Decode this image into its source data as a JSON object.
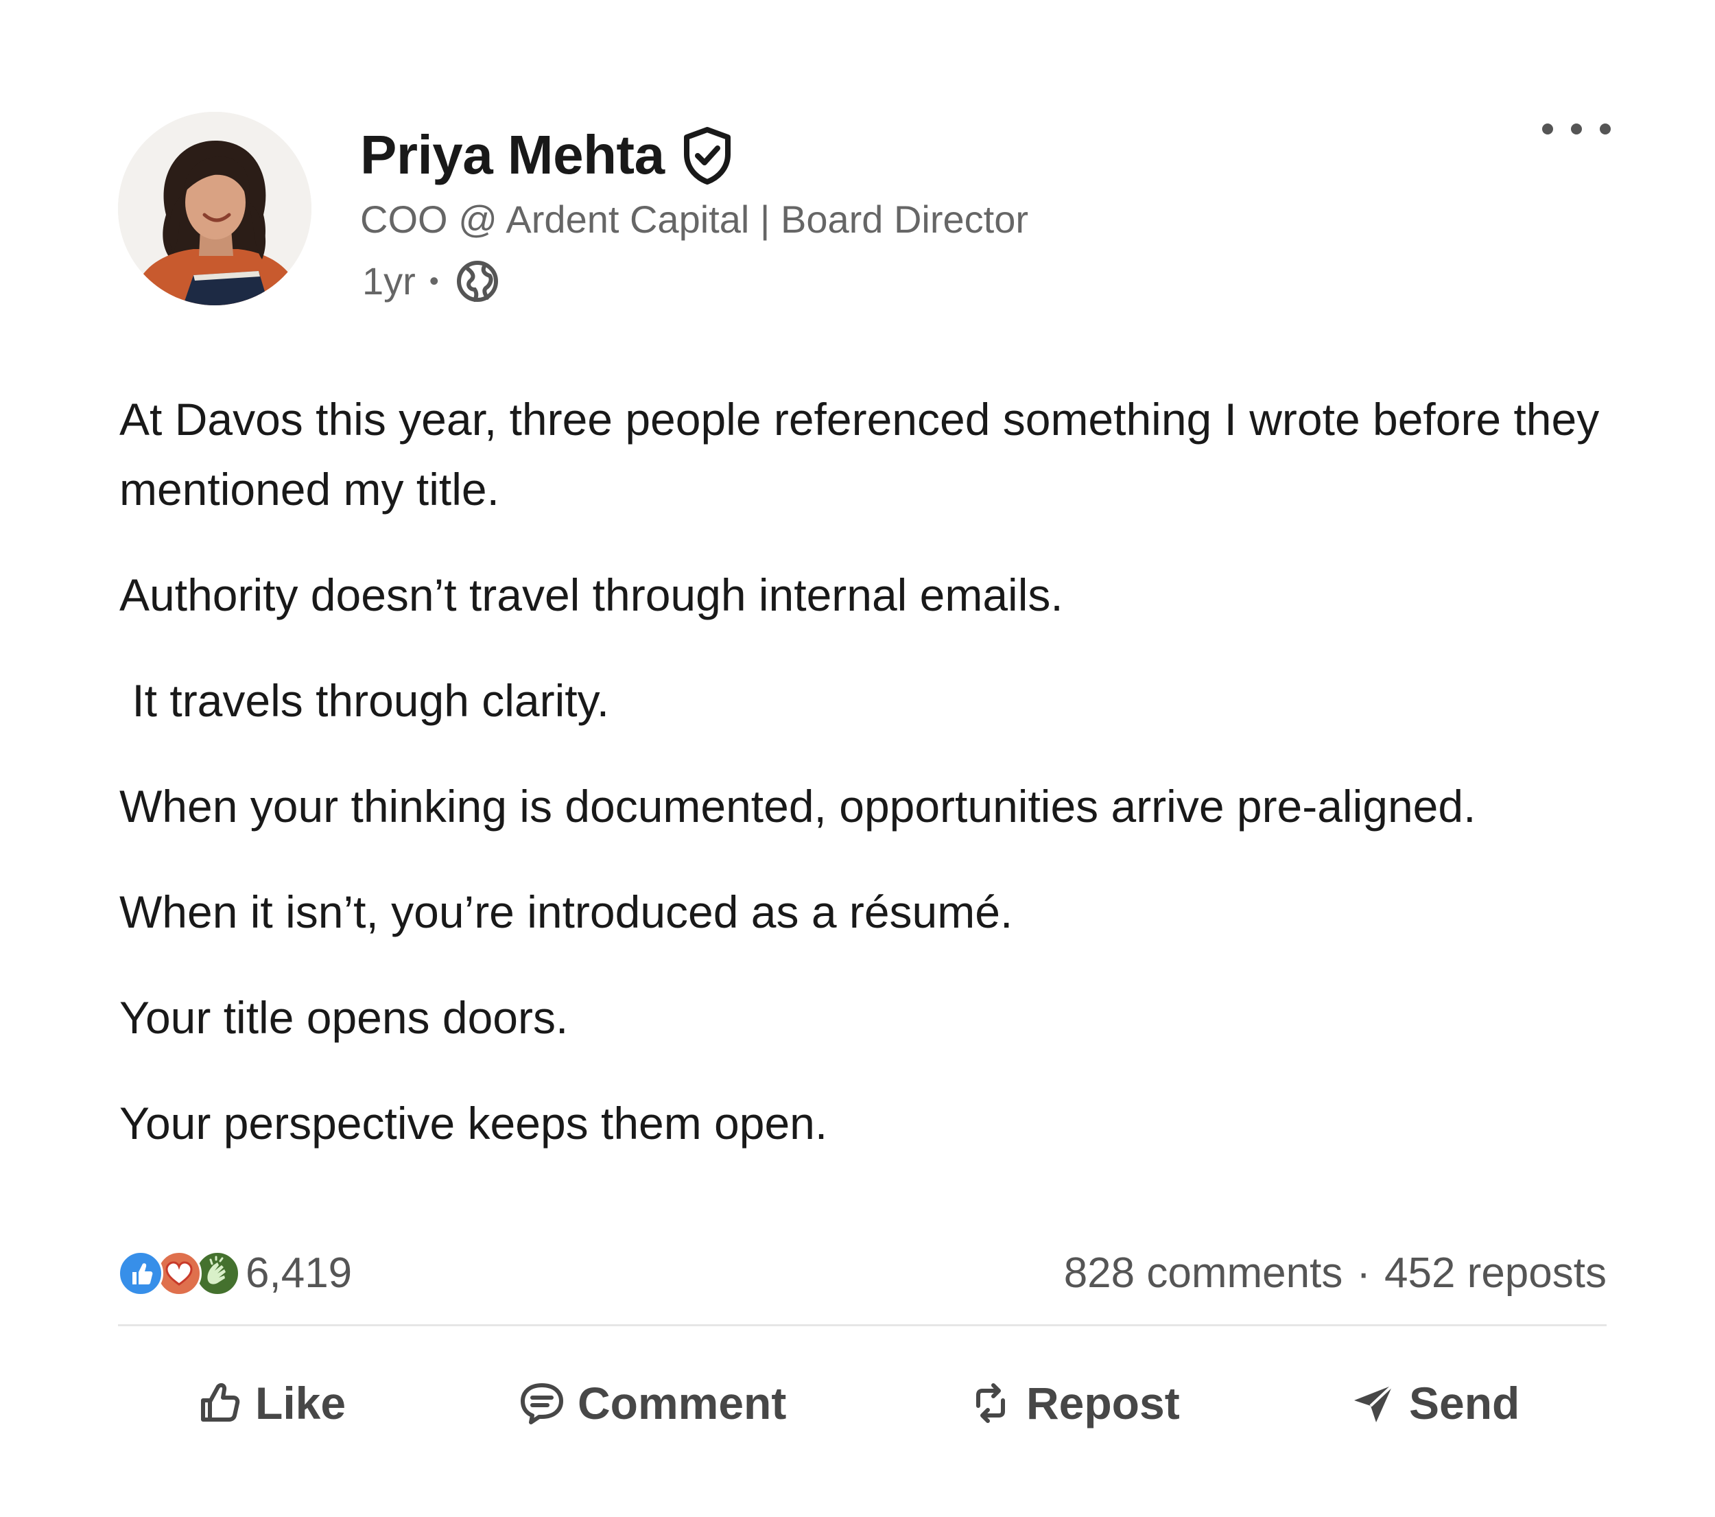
{
  "author": {
    "name": "Priya Mehta",
    "headline": "COO @ Ardent Capital | Board Director",
    "time": "1yr",
    "meta_separator": "•"
  },
  "icons": {
    "verified": "shield-check-icon",
    "visibility": "globe-icon",
    "more": "more-horizontal-icon",
    "like_reaction": "thumbs-up-reaction-icon",
    "love_reaction": "heart-reaction-icon",
    "praise_reaction": "clapping-hands-reaction-icon",
    "like_action": "thumbs-up-icon",
    "comment_action": "speech-bubble-icon",
    "repost_action": "repost-arrows-icon",
    "send_action": "paper-plane-icon"
  },
  "post": {
    "paragraphs": [
      "At Davos this year, three people referenced something I wrote before they mentioned my title.",
      "Authority doesn’t travel through internal emails.",
      " It travels through clarity.",
      "When your thinking is documented, opportunities arrive pre-aligned.",
      "When it isn’t, you’re introduced as a résumé.",
      "Your title opens doors.",
      "Your perspective keeps them open."
    ]
  },
  "social": {
    "reaction_count": "6,419",
    "comments": "828 comments",
    "separator": "·",
    "reposts": "452 reposts"
  },
  "actions": {
    "like": "Like",
    "comment": "Comment",
    "repost": "Repost",
    "send": "Send"
  },
  "colors": {
    "text_primary": "#191919",
    "text_secondary": "#666666",
    "action_text": "#474747",
    "like_blue": "#378fe9",
    "love_orange": "#df704d",
    "praise_green": "#44712e",
    "divider": "#e6e6e6"
  }
}
